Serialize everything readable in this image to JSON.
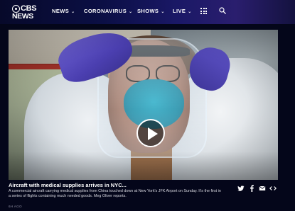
{
  "header": {
    "logo": {
      "line1": "CBS",
      "line2": "NEWS"
    },
    "nav": [
      {
        "label": "NEWS",
        "has_chevron": true
      },
      {
        "label": "CORONAVIRUS",
        "has_chevron": true
      },
      {
        "label": "SHOWS",
        "has_chevron": true
      },
      {
        "label": "LIVE",
        "has_chevron": true
      }
    ],
    "chevron": "⌄",
    "icons": [
      "grid-menu-icon",
      "search-icon"
    ]
  },
  "video": {
    "play_icon": "play-icon"
  },
  "caption": {
    "title": "Aircraft with medical supplies arrives in NYC...",
    "description": "A commercial aircraft carrying medical supplies from China touched down at New York's JFK Airport on Sunday. It's the first in a series of flights containing much needed goods. Meg Oliver reports.",
    "time": "6H AGO"
  },
  "share": {
    "icons": [
      "twitter-icon",
      "facebook-icon",
      "email-icon",
      "embed-icon"
    ]
  },
  "colors": {
    "header_bg_start": "#07092a",
    "header_bg_mid": "#1a1866",
    "page_bg": "#04061a",
    "mask": "#2bb0c9",
    "glove": "#5d52c7"
  }
}
